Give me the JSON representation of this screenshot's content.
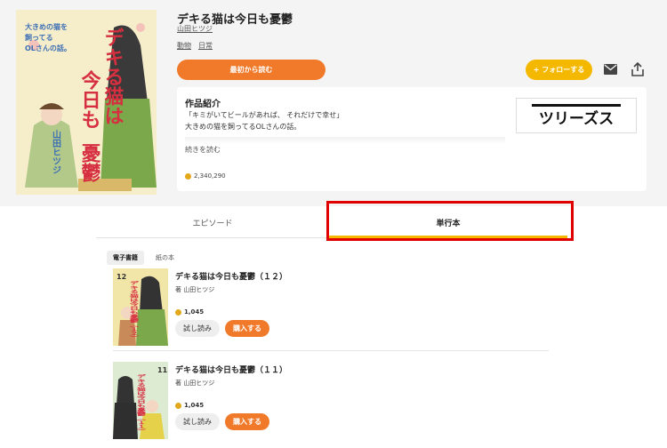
{
  "series": {
    "title": "デキる猫は今日も憂鬱",
    "author": "山田ヒツジ",
    "tags": [
      "動物",
      "日常"
    ],
    "read_first_label": "最初から読む",
    "follow_label": "+ フォローする",
    "cover_text": {
      "title": "デキる猫は今日も憂鬱",
      "subtitle": "大きめの猫を飼ってるOLさんの話。",
      "author": "山田ヒツジ"
    }
  },
  "intro": {
    "heading": "作品紹介",
    "lines": [
      "「キミがいてビールがあれば、 それだけで幸せ」",
      "大きめの猫を飼ってるOLさんの話。"
    ],
    "more_label": "続きを読む",
    "view_count": "2,340,290",
    "magazine_logo": "ツリーズス"
  },
  "tabs": [
    {
      "label": "エピソード",
      "active": false
    },
    {
      "label": "単行本",
      "active": true
    }
  ],
  "subtabs": [
    {
      "label": "電子書籍",
      "active": true
    },
    {
      "label": "紙の本",
      "active": false
    }
  ],
  "volumes": [
    {
      "title": "デキる猫は今日も憂鬱（１２）",
      "author": "著 山田ヒツジ",
      "price": "1,045",
      "trial_label": "試し読み",
      "buy_label": "購入する",
      "cover_number": "12",
      "cover_color": "#f1e6a8"
    },
    {
      "title": "デキる猫は今日も憂鬱（１１）",
      "author": "著 山田ヒツジ",
      "price": "1,045",
      "trial_label": "試し読み",
      "buy_label": "購入する",
      "cover_number": "11",
      "cover_color": "#dcebd2"
    }
  ],
  "colors": {
    "accent_orange": "#f07a2a",
    "accent_yellow": "#f5b800",
    "highlight_red": "#e00000",
    "coin": "#e3a81a"
  },
  "icons": [
    "mail-icon",
    "share-icon",
    "coin-icon"
  ]
}
